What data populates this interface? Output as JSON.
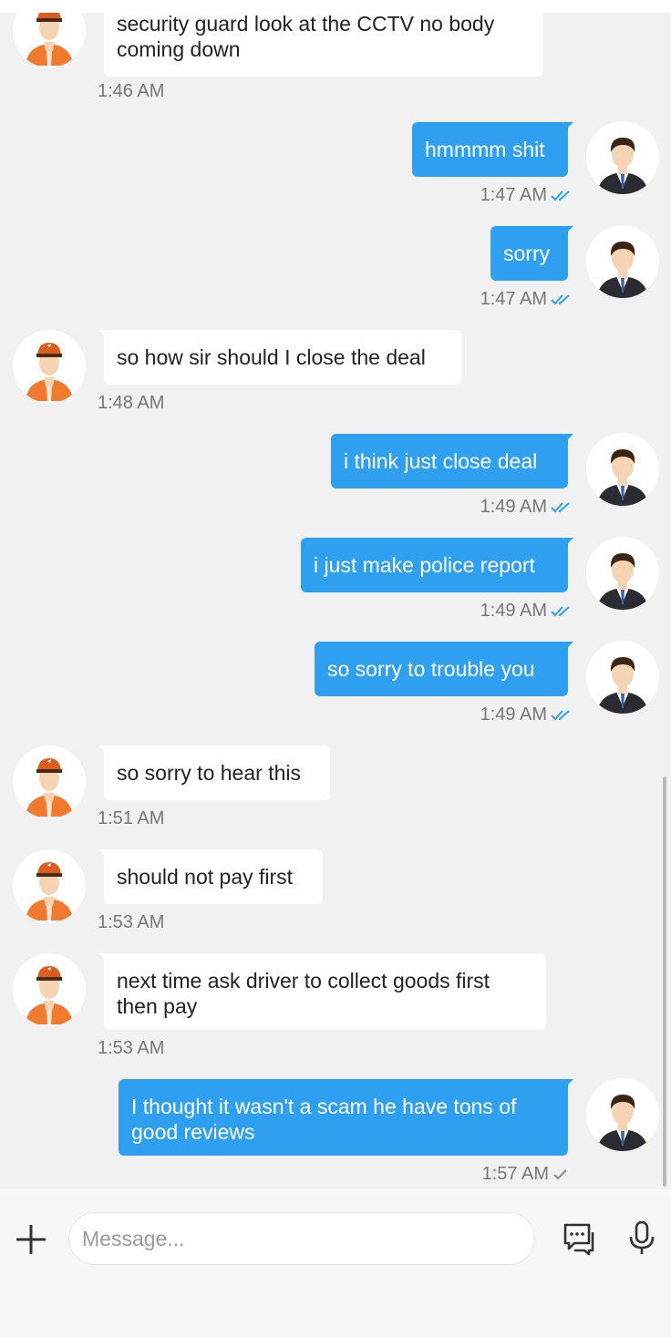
{
  "messages": [
    {
      "side": "in",
      "text": "security guard look at the CCTV no body coming down",
      "time": "1:46 AM"
    },
    {
      "side": "out",
      "text": "hmmmm shit",
      "time": "1:47 AM",
      "status": "read"
    },
    {
      "side": "out",
      "text": "sorry",
      "time": "1:47 AM",
      "status": "read"
    },
    {
      "side": "in",
      "text": "so how sir should I close the deal",
      "time": "1:48 AM"
    },
    {
      "side": "out",
      "text": "i think just close deal",
      "time": "1:49 AM",
      "status": "read"
    },
    {
      "side": "out",
      "text": "i just make police report",
      "time": "1:49 AM",
      "status": "read"
    },
    {
      "side": "out",
      "text": "so sorry to trouble you",
      "time": "1:49 AM",
      "status": "read"
    },
    {
      "side": "in",
      "text": "so sorry to hear this",
      "time": "1:51 AM"
    },
    {
      "side": "in",
      "text": "should not pay first",
      "time": "1:53 AM"
    },
    {
      "side": "in",
      "text": "next time ask driver to collect goods first then pay",
      "time": "1:53 AM"
    },
    {
      "side": "out",
      "text": "I thought it wasn't a scam he have tons of good reviews",
      "time": "1:57 AM",
      "status": "sent"
    }
  ],
  "composer": {
    "placeholder": "Message...",
    "icons": [
      "plus-icon",
      "quick-reply-icon",
      "microphone-icon"
    ]
  },
  "colors": {
    "outgoing_bubble": "#2f9ff0",
    "incoming_bubble": "#ffffff",
    "background": "#f1f1f1",
    "read_check": "#2f9ff0",
    "sent_check": "#8a8a8a",
    "courier_uniform": "#f07a2e"
  },
  "avatars": {
    "incoming": "courier-avatar-icon",
    "outgoing": "businessman-avatar-icon"
  }
}
